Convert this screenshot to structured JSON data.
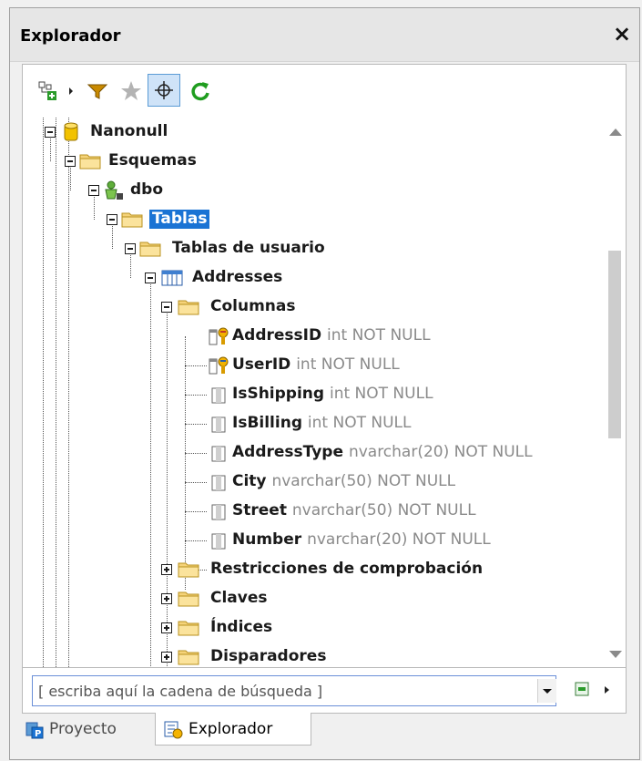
{
  "window": {
    "title": "Explorador",
    "close_glyph": "×"
  },
  "toolbar": {
    "icons": [
      "add-object-icon",
      "filter-icon",
      "favorites-star-icon",
      "locate-icon",
      "refresh-icon"
    ],
    "colors": {
      "filter": "#c98a00",
      "star": "#b3b3b3",
      "locate_active_bg": "#cfe3f8",
      "refresh": "#1f9d1f"
    }
  },
  "tree": {
    "database": "Nanonull",
    "schemas": "Esquemas",
    "schema": "dbo",
    "tables": "Tablas",
    "user_tables": "Tablas de usuario",
    "table": "Addresses",
    "columns_folder": "Columnas",
    "columns": [
      {
        "name": "AddressID",
        "type": "int NOT NULL",
        "icon": "primary-key-column-icon"
      },
      {
        "name": "UserID",
        "type": "int NOT NULL",
        "icon": "primary-key-column-icon"
      },
      {
        "name": "IsShipping",
        "type": "int NOT NULL",
        "icon": "column-icon"
      },
      {
        "name": "IsBilling",
        "type": "int NOT NULL",
        "icon": "column-icon"
      },
      {
        "name": "AddressType",
        "type": "nvarchar(20) NOT NULL",
        "icon": "column-icon"
      },
      {
        "name": "City",
        "type": "nvarchar(50) NOT NULL",
        "icon": "column-icon"
      },
      {
        "name": "Street",
        "type": "nvarchar(50) NOT NULL",
        "icon": "column-icon"
      },
      {
        "name": "Number",
        "type": "nvarchar(20) NOT NULL",
        "icon": "column-icon"
      }
    ],
    "folders": [
      "Restricciones de comprobación",
      "Claves",
      "Índices",
      "Disparadores"
    ]
  },
  "search": {
    "placeholder": "[ escriba aquí la cadena de búsqueda ]",
    "value": ""
  },
  "tabs": [
    {
      "label": "Proyecto",
      "active": false,
      "icon": "project-icon"
    },
    {
      "label": "Explorador",
      "active": true,
      "icon": "explorer-icon"
    }
  ],
  "colors": {
    "selection": "#1a73d4",
    "folder": "#f5d37a",
    "database": "#f2c200"
  }
}
